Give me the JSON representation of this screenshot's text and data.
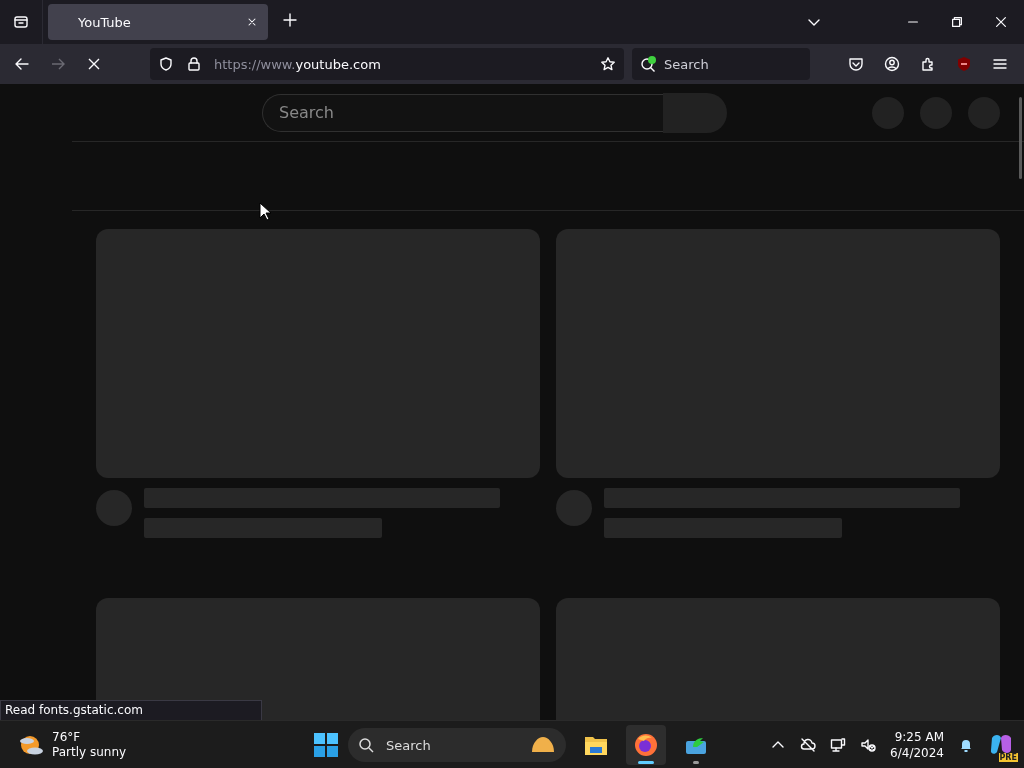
{
  "tabs": [
    {
      "title": "YouTube",
      "selected": true
    }
  ],
  "address": {
    "scheme": "https://www.",
    "domain": "youtube.com"
  },
  "toolbar_search": {
    "placeholder": "Search"
  },
  "page": {
    "search": {
      "placeholder": "Search"
    },
    "loading": true,
    "cards": [
      {
        "kind": "skeleton"
      },
      {
        "kind": "skeleton"
      },
      {
        "kind": "skeleton"
      },
      {
        "kind": "skeleton"
      }
    ]
  },
  "status_text": "Read fonts.gstatic.com",
  "taskbar": {
    "weather": {
      "temperature": "76°F",
      "condition": "Partly sunny"
    },
    "search": {
      "placeholder": "Search"
    },
    "apps": [
      {
        "kind": "files",
        "selected": false,
        "running": false
      },
      {
        "kind": "firefox",
        "selected": true,
        "running": true
      },
      {
        "kind": "app",
        "selected": false,
        "running": true
      }
    ],
    "time": "9:25 AM",
    "date": "6/4/2024",
    "badge": "PRE"
  }
}
